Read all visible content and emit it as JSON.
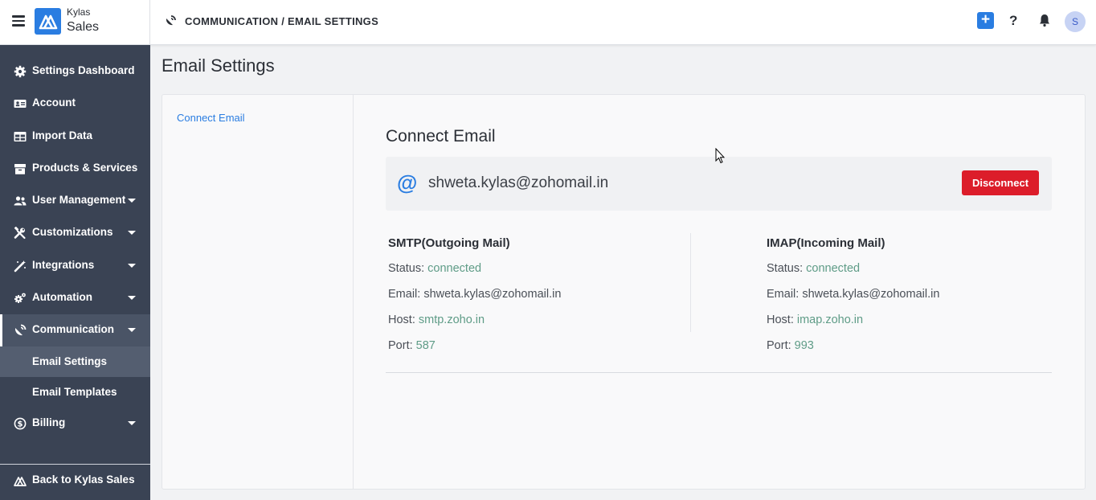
{
  "header": {
    "brand_top": "Kylas",
    "brand_bottom": "Sales",
    "breadcrumb": "COMMUNICATION / EMAIL SETTINGS",
    "plus_label": "+",
    "help_label": "?",
    "avatar_initial": "S",
    "accent_color": "#2a7de1"
  },
  "sidebar": {
    "items": [
      {
        "label": "Settings Dashboard",
        "icon": "gear-icon"
      },
      {
        "label": "Account",
        "icon": "id-card-icon"
      },
      {
        "label": "Import Data",
        "icon": "table-icon"
      },
      {
        "label": "Products & Services",
        "icon": "box-icon"
      },
      {
        "label": "User Management",
        "icon": "users-icon"
      },
      {
        "label": "Customizations",
        "icon": "tools-icon"
      },
      {
        "label": "Integrations",
        "icon": "magic-wand-icon"
      },
      {
        "label": "Automation",
        "icon": "cogs-icon"
      },
      {
        "label": "Communication",
        "icon": "satellite-dish-icon"
      },
      {
        "label": "Billing",
        "icon": "dollar-circle-icon"
      }
    ],
    "sub_items": [
      {
        "label": "Email Settings"
      },
      {
        "label": "Email Templates"
      }
    ],
    "back_label": "Back to Kylas Sales"
  },
  "main": {
    "page_title": "Email Settings",
    "side_link": "Connect Email",
    "section_title": "Connect Email",
    "connected_email": "shweta.kylas@zohomail.in",
    "disconnect_label": "Disconnect",
    "smtp": {
      "title": "SMTP(Outgoing Mail)",
      "status_label": "Status: ",
      "status_value": "connected",
      "email_label": "Email: ",
      "email_value": "shweta.kylas@zohomail.in",
      "host_label": "Host: ",
      "host_value": "smtp.zoho.in",
      "port_label": "Port: ",
      "port_value": "587"
    },
    "imap": {
      "title": "IMAP(Incoming Mail)",
      "status_label": "Status: ",
      "status_value": "connected",
      "email_label": "Email: ",
      "email_value": "shweta.kylas@zohomail.in",
      "host_label": "Host: ",
      "host_value": "imap.zoho.in",
      "port_label": "Port: ",
      "port_value": "993"
    }
  }
}
